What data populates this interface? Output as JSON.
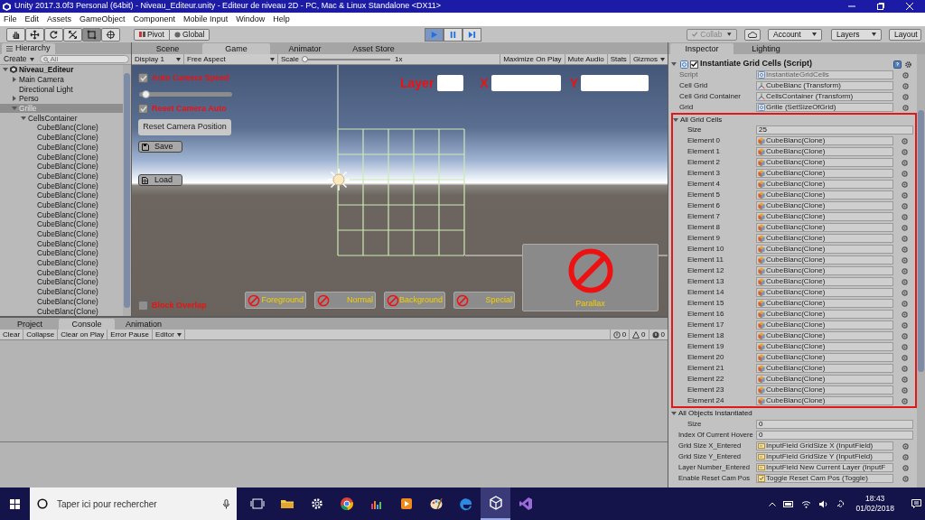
{
  "window": {
    "title": "Unity 2017.3.0f3 Personal (64bit) - Niveau_Editeur.unity - Editeur de niveau 2D - PC, Mac & Linux Standalone <DX11>"
  },
  "menu": [
    "File",
    "Edit",
    "Assets",
    "GameObject",
    "Component",
    "Mobile Input",
    "Window",
    "Help"
  ],
  "toolbar": {
    "tools": [
      {
        "kind": "hand",
        "selected": false
      },
      {
        "kind": "move",
        "selected": false
      },
      {
        "kind": "rotate",
        "selected": false
      },
      {
        "kind": "scale",
        "selected": false
      },
      {
        "kind": "rect",
        "selected": true
      },
      {
        "kind": "transform",
        "selected": false
      }
    ],
    "pivot": "Pivot",
    "global": "Global",
    "playback": [
      {
        "kind": "play",
        "selected": true
      },
      {
        "kind": "pause",
        "selected": false
      },
      {
        "kind": "step",
        "selected": false
      }
    ],
    "collab": {
      "label": "Collab",
      "disabled": true
    },
    "account": "Account",
    "layers": "Layers",
    "layout": "Layout"
  },
  "hierarchy": {
    "tab": "Hierarchy",
    "create": "Create",
    "search": {
      "placeholder": "All"
    },
    "tree": [
      {
        "label": "Niveau_Editeur",
        "expanded": true,
        "selected": false,
        "children": [
          {
            "label": "Main Camera",
            "expanded": false,
            "selected": false
          },
          {
            "label": "Directional Light",
            "selected": false
          },
          {
            "label": "Perso",
            "expanded": false,
            "selected": false
          },
          {
            "label": "Grille",
            "expanded": true,
            "selected": true,
            "children": [
              {
                "label": "CellsContainer",
                "expanded": true,
                "selected": false,
                "children": [
                  {
                    "label": "CubeBlanc(Clone)",
                    "selected": false
                  },
                  {
                    "label": "CubeBlanc(Clone)",
                    "selected": false
                  },
                  {
                    "label": "CubeBlanc(Clone)",
                    "selected": false
                  },
                  {
                    "label": "CubeBlanc(Clone)",
                    "selected": false
                  },
                  {
                    "label": "CubeBlanc(Clone)",
                    "selected": false
                  },
                  {
                    "label": "CubeBlanc(Clone)",
                    "selected": false
                  },
                  {
                    "label": "CubeBlanc(Clone)",
                    "selected": false
                  },
                  {
                    "label": "CubeBlanc(Clone)",
                    "selected": false
                  },
                  {
                    "label": "CubeBlanc(Clone)",
                    "selected": false
                  },
                  {
                    "label": "CubeBlanc(Clone)",
                    "selected": false
                  },
                  {
                    "label": "CubeBlanc(Clone)",
                    "selected": false
                  },
                  {
                    "label": "CubeBlanc(Clone)",
                    "selected": false
                  },
                  {
                    "label": "CubeBlanc(Clone)",
                    "selected": false
                  },
                  {
                    "label": "CubeBlanc(Clone)",
                    "selected": false
                  },
                  {
                    "label": "CubeBlanc(Clone)",
                    "selected": false
                  },
                  {
                    "label": "CubeBlanc(Clone)",
                    "selected": false
                  },
                  {
                    "label": "CubeBlanc(Clone)",
                    "selected": false
                  },
                  {
                    "label": "CubeBlanc(Clone)",
                    "selected": false
                  },
                  {
                    "label": "CubeBlanc(Clone)",
                    "selected": false
                  },
                  {
                    "label": "CubeBlanc(Clone)",
                    "selected": false
                  }
                ]
              }
            ]
          }
        ]
      }
    ]
  },
  "game": {
    "tabs": [
      {
        "label": "Scene",
        "selected": false
      },
      {
        "label": "Game",
        "selected": true
      },
      {
        "label": "Animator",
        "selected": false
      },
      {
        "label": "Asset Store",
        "selected": false
      }
    ],
    "display": "Display 1",
    "aspect": "Free Aspect",
    "scale_label": "Scale",
    "scale": {
      "level": 0
    },
    "scale_value": "1x",
    "buttons": [
      "Maximize On Play",
      "Mute Audio",
      "Stats"
    ],
    "gizmos": "Gizmos",
    "overlay": {
      "toggles": [
        {
          "label": "Auto Camera Speed",
          "checked": true
        },
        {
          "label": "Reset Camera Auto",
          "checked": true
        }
      ],
      "speed_slider": {
        "level": 0.03
      },
      "reset_button": "Reset Camera Position",
      "save_button": "Save",
      "load_button": "Load",
      "block_overlap": {
        "label": "Block Overlap",
        "checked": false
      },
      "fields": [
        {
          "label": "Layer"
        },
        {
          "label": "X"
        },
        {
          "label": "Y"
        }
      ],
      "brushes": [
        "Foreground",
        "Normal",
        "Background",
        "Special"
      ],
      "parallax": "Parallax"
    }
  },
  "inspector": {
    "tabs": [
      {
        "label": "Inspector",
        "selected": true
      },
      {
        "label": "Lighting",
        "selected": false
      }
    ],
    "component": {
      "title": "Instantiate Grid Cells (Script)",
      "enabled": true,
      "expanded": true
    },
    "fields": [
      {
        "label": "Script",
        "kind": "script",
        "value": "InstantiateGridCells",
        "disabled": true
      },
      {
        "label": "Cell Grid",
        "kind": "transform",
        "value": "CubeBlanc (Transform)",
        "disabled": false
      },
      {
        "label": "Cell Grid Container",
        "kind": "transform",
        "value": "CellsContainer (Transform)",
        "disabled": false
      },
      {
        "label": "Grid",
        "kind": "script",
        "value": "Grille (SetSizeOfGrid)",
        "disabled": false
      }
    ],
    "all_grid_cells": {
      "label": "All Grid Cells",
      "expanded": true,
      "highlighted": true,
      "size_label": "Size",
      "size": "25",
      "elements": [
        {
          "label": "Element 0",
          "value": "CubeBlanc(Clone)"
        },
        {
          "label": "Element 1",
          "value": "CubeBlanc(Clone)"
        },
        {
          "label": "Element 2",
          "value": "CubeBlanc(Clone)"
        },
        {
          "label": "Element 3",
          "value": "CubeBlanc(Clone)"
        },
        {
          "label": "Element 4",
          "value": "CubeBlanc(Clone)"
        },
        {
          "label": "Element 5",
          "value": "CubeBlanc(Clone)"
        },
        {
          "label": "Element 6",
          "value": "CubeBlanc(Clone)"
        },
        {
          "label": "Element 7",
          "value": "CubeBlanc(Clone)"
        },
        {
          "label": "Element 8",
          "value": "CubeBlanc(Clone)"
        },
        {
          "label": "Element 9",
          "value": "CubeBlanc(Clone)"
        },
        {
          "label": "Element 10",
          "value": "CubeBlanc(Clone)"
        },
        {
          "label": "Element 11",
          "value": "CubeBlanc(Clone)"
        },
        {
          "label": "Element 12",
          "value": "CubeBlanc(Clone)"
        },
        {
          "label": "Element 13",
          "value": "CubeBlanc(Clone)"
        },
        {
          "label": "Element 14",
          "value": "CubeBlanc(Clone)"
        },
        {
          "label": "Element 15",
          "value": "CubeBlanc(Clone)"
        },
        {
          "label": "Element 16",
          "value": "CubeBlanc(Clone)"
        },
        {
          "label": "Element 17",
          "value": "CubeBlanc(Clone)"
        },
        {
          "label": "Element 18",
          "value": "CubeBlanc(Clone)"
        },
        {
          "label": "Element 19",
          "value": "CubeBlanc(Clone)"
        },
        {
          "label": "Element 20",
          "value": "CubeBlanc(Clone)"
        },
        {
          "label": "Element 21",
          "value": "CubeBlanc(Clone)"
        },
        {
          "label": "Element 22",
          "value": "CubeBlanc(Clone)"
        },
        {
          "label": "Element 23",
          "value": "CubeBlanc(Clone)"
        },
        {
          "label": "Element 24",
          "value": "CubeBlanc(Clone)"
        }
      ]
    },
    "all_objects": {
      "label": "All Objects Instantiated",
      "expanded": true,
      "size_label": "Size",
      "size": "0"
    },
    "more_fields": [
      {
        "label": "Index Of Current Hovere",
        "kind": "number",
        "value": "0"
      },
      {
        "label": "Grid Size X_Entered",
        "kind": "input",
        "value": "InputField GridSize X (InputField)"
      },
      {
        "label": "Grid Size Y_Entered",
        "kind": "input",
        "value": "InputField GridSize Y (InputField)"
      },
      {
        "label": "Layer Number_Entered",
        "kind": "input",
        "value": "InputField New Current Layer (InputF"
      },
      {
        "label": "Enable Reset Cam Pos",
        "kind": "toggle",
        "value": "Toggle Reset Cam Pos (Toggle)"
      }
    ]
  },
  "console": {
    "tabs": [
      {
        "label": "Project",
        "selected": false
      },
      {
        "label": "Console",
        "selected": true
      },
      {
        "label": "Animation",
        "selected": false
      }
    ],
    "buttons": [
      "Clear",
      "Collapse",
      "Clear on Play",
      "Error Pause"
    ],
    "editor": "Editor",
    "counts": [
      {
        "kind": "info",
        "count": "0"
      },
      {
        "kind": "warning",
        "count": "0"
      },
      {
        "kind": "error",
        "count": "0"
      }
    ]
  },
  "taskbar": {
    "search": {
      "placeholder": "Taper ici pour rechercher"
    },
    "apps": [
      {
        "kind": "task-view",
        "selected": false
      },
      {
        "kind": "folder",
        "selected": false
      },
      {
        "kind": "gear",
        "selected": false
      },
      {
        "kind": "browser",
        "selected": false
      },
      {
        "kind": "equalizer",
        "selected": false
      },
      {
        "kind": "media",
        "selected": false
      },
      {
        "kind": "palette",
        "selected": false
      },
      {
        "kind": "edge",
        "selected": false
      },
      {
        "kind": "unity",
        "selected": true
      },
      {
        "kind": "studio",
        "selected": false
      }
    ],
    "time": "18:43",
    "date": "01/02/2018"
  }
}
